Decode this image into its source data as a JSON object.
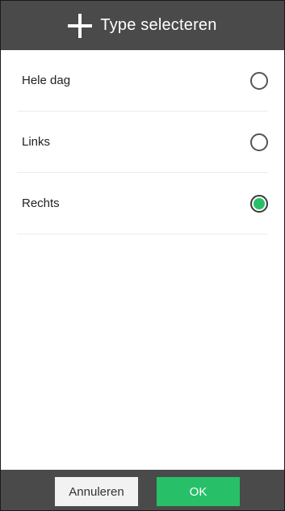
{
  "header": {
    "icon": "plus-icon",
    "title": "Type selecteren"
  },
  "options": [
    {
      "label": "Hele dag",
      "selected": false
    },
    {
      "label": "Links",
      "selected": false
    },
    {
      "label": "Rechts",
      "selected": true
    }
  ],
  "footer": {
    "cancel_label": "Annuleren",
    "ok_label": "OK"
  },
  "colors": {
    "header_bg": "#4a4a4a",
    "accent": "#27c069",
    "cancel_bg": "#f2f2f2"
  }
}
